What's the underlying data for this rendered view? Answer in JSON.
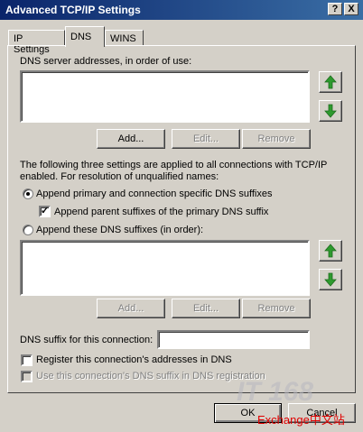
{
  "window": {
    "title": "Advanced TCP/IP Settings",
    "help_button": "?",
    "close_button": "X"
  },
  "tabs": [
    {
      "label": "IP Settings"
    },
    {
      "label": "DNS"
    },
    {
      "label": "WINS"
    }
  ],
  "dns": {
    "servers_label": "DNS server addresses, in order of use:",
    "servers": [],
    "add_label": "Add...",
    "edit_label": "Edit...",
    "remove_label": "Remove",
    "info_text_line1": "The following three settings are applied to all connections with TCP/IP",
    "info_text_line2": "enabled. For resolution of unqualified names:",
    "radio_primary_label": "Append primary and connection specific DNS suffixes",
    "radio_primary_checked": true,
    "check_parent_label": "Append parent suffixes of the primary DNS suffix",
    "check_parent_checked": true,
    "radio_these_label": "Append these DNS suffixes (in order):",
    "radio_these_checked": false,
    "suffixes": [],
    "add2_label": "Add...",
    "edit2_label": "Edit...",
    "remove2_label": "Remove",
    "suffix_label": "DNS suffix for this connection:",
    "suffix_value": "",
    "register_label": "Register this connection's addresses in DNS",
    "register_checked": false,
    "use_suffix_label": "Use this connection's DNS suffix in DNS registration",
    "use_suffix_checked": false
  },
  "footer": {
    "ok_label": "OK",
    "cancel_label": "Cancel"
  },
  "watermark": {
    "logo_text": "IT 168",
    "site_text": "Exchange中文站"
  },
  "colors": {
    "titlebar_start": "#0a246a",
    "titlebar_end": "#3a6ea5",
    "dialog_bg": "#d4d0c8",
    "arrow_green": "#2e9a2e"
  }
}
